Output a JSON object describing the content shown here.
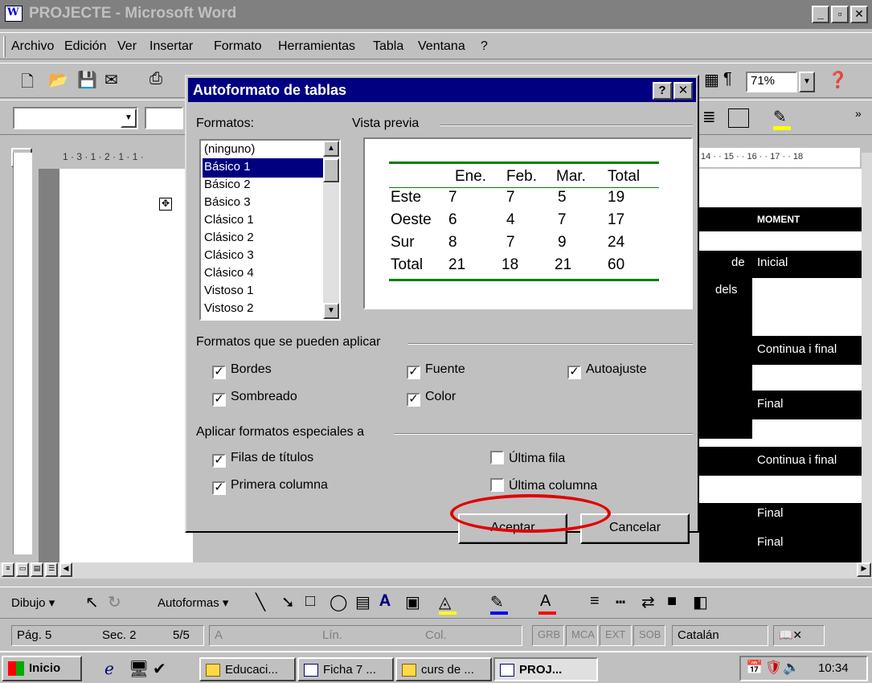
{
  "window": {
    "title": "PROJECTE - Microsoft Word",
    "min": "_",
    "max": "▫",
    "close": "✕"
  },
  "menu": [
    "Archivo",
    "Edición",
    "Ver",
    "Insertar",
    "Formato",
    "Herramientas",
    "Tabla",
    "Ventana",
    "?"
  ],
  "toolbar": {
    "zoom": "71%"
  },
  "ruler": {
    "left": "1 · 3 · 1 · 2 · 1 · 1 ·",
    "right": "14 · · 15 · · 16 · · 17 · · 18"
  },
  "dialog": {
    "title": "Autoformato de tablas",
    "help": "?",
    "close": "✕",
    "formats_label": "Formatos:",
    "formats": [
      "(ninguno)",
      "Básico 1",
      "Básico 2",
      "Básico 3",
      "Clásico 1",
      "Clásico 2",
      "Clásico 3",
      "Clásico 4",
      "Vistoso 1",
      "Vistoso 2"
    ],
    "selected_format": "Básico 1",
    "preview_label": "Vista previa",
    "preview_table": {
      "header": [
        "Ene.",
        "Feb.",
        "Mar.",
        "Total"
      ],
      "rows": [
        [
          "Este",
          "7",
          "7",
          "5",
          "19"
        ],
        [
          "Oeste",
          "6",
          "4",
          "7",
          "17"
        ],
        [
          "Sur",
          "8",
          "7",
          "9",
          "24"
        ],
        [
          "Total",
          "21",
          "18",
          "21",
          "60"
        ]
      ]
    },
    "apply_group_label": "Formatos que se pueden aplicar",
    "apply_options": [
      {
        "label": "Bordes",
        "checked": true
      },
      {
        "label": "Fuente",
        "checked": true
      },
      {
        "label": "Autoajuste",
        "checked": true
      },
      {
        "label": "Sombreado",
        "checked": true
      },
      {
        "label": "Color",
        "checked": true
      }
    ],
    "special_group_label": "Aplicar formatos especiales a",
    "special_options": [
      {
        "label": "Filas de títulos",
        "checked": true
      },
      {
        "label": "Última fila",
        "checked": false
      },
      {
        "label": "Primera columna",
        "checked": true
      },
      {
        "label": "Última columna",
        "checked": false
      }
    ],
    "ok_label": "Aceptar",
    "cancel_label": "Cancelar"
  },
  "document": {
    "cells": [
      "MOMENT",
      "de",
      "Inicial",
      "dels",
      "Continua i final",
      "Final",
      "Continua i final",
      "Final",
      "Final"
    ]
  },
  "drawbar": {
    "dibujo": "Dibujo",
    "autoformas": "Autoformas"
  },
  "status": {
    "page": "Pág. 5",
    "section": "Sec. 2",
    "pages": "5/5",
    "at": "A",
    "line": "Lín.",
    "col": "Col.",
    "grb": "GRB",
    "mca": "MCA",
    "ext": "EXT",
    "sob": "SOB",
    "lang": "Catalán"
  },
  "taskbar": {
    "start": "Inicio",
    "tasks": [
      "Educaci...",
      "Ficha 7 ...",
      "curs de ...",
      "PROJ..."
    ],
    "clock": "10:34"
  }
}
